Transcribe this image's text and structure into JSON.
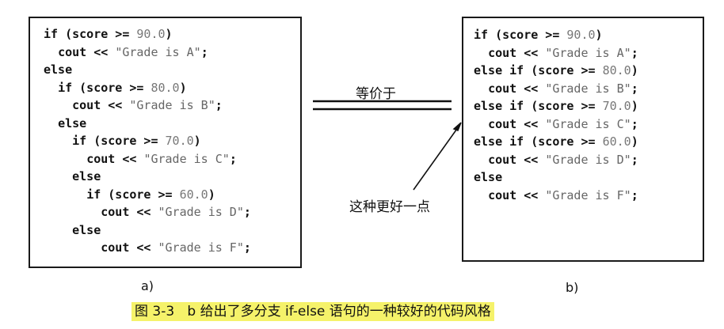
{
  "panel_a": {
    "label": "a)",
    "lines": [
      {
        "indent": 0,
        "parts": [
          [
            "kw",
            "if (score >= "
          ],
          [
            "num",
            "90.0"
          ],
          [
            "kw",
            ")"
          ]
        ]
      },
      {
        "indent": 1,
        "parts": [
          [
            "kw",
            "cout << "
          ],
          [
            "str",
            "\"Grade is A\""
          ],
          [
            "kw",
            ";"
          ]
        ]
      },
      {
        "indent": 0,
        "parts": [
          [
            "kw",
            "else"
          ]
        ]
      },
      {
        "indent": 1,
        "parts": [
          [
            "kw",
            "if (score >= "
          ],
          [
            "num",
            "80.0"
          ],
          [
            "kw",
            ")"
          ]
        ]
      },
      {
        "indent": 2,
        "parts": [
          [
            "kw",
            "cout << "
          ],
          [
            "str",
            "\"Grade is B\""
          ],
          [
            "kw",
            ";"
          ]
        ]
      },
      {
        "indent": 1,
        "parts": [
          [
            "kw",
            "else"
          ]
        ]
      },
      {
        "indent": 2,
        "parts": [
          [
            "kw",
            "if (score >= "
          ],
          [
            "num",
            "70.0"
          ],
          [
            "kw",
            ")"
          ]
        ]
      },
      {
        "indent": 3,
        "parts": [
          [
            "kw",
            "cout << "
          ],
          [
            "str",
            "\"Grade is C\""
          ],
          [
            "kw",
            ";"
          ]
        ]
      },
      {
        "indent": 2,
        "parts": [
          [
            "kw",
            "else"
          ]
        ]
      },
      {
        "indent": 3,
        "parts": [
          [
            "kw",
            "if (score >= "
          ],
          [
            "num",
            "60.0"
          ],
          [
            "kw",
            ")"
          ]
        ]
      },
      {
        "indent": 4,
        "parts": [
          [
            "kw",
            "cout << "
          ],
          [
            "str",
            "\"Grade is D\""
          ],
          [
            "kw",
            ";"
          ]
        ]
      },
      {
        "indent": 2,
        "parts": [
          [
            "kw",
            "else"
          ]
        ]
      },
      {
        "indent": 4,
        "parts": [
          [
            "kw",
            "cout << "
          ],
          [
            "str",
            "\"Grade is F\""
          ],
          [
            "kw",
            ";"
          ]
        ]
      }
    ]
  },
  "panel_b": {
    "label": "b)",
    "lines": [
      {
        "indent": 0,
        "parts": [
          [
            "kw",
            "if (score >= "
          ],
          [
            "num",
            "90.0"
          ],
          [
            "kw",
            ")"
          ]
        ]
      },
      {
        "indent": 1,
        "parts": [
          [
            "kw",
            "cout << "
          ],
          [
            "str",
            "\"Grade is A\""
          ],
          [
            "kw",
            ";"
          ]
        ]
      },
      {
        "indent": 0,
        "parts": [
          [
            "kw",
            "else if (score >= "
          ],
          [
            "num",
            "80.0"
          ],
          [
            "kw",
            ")"
          ]
        ]
      },
      {
        "indent": 1,
        "parts": [
          [
            "kw",
            "cout << "
          ],
          [
            "str",
            "\"Grade is B\""
          ],
          [
            "kw",
            ";"
          ]
        ]
      },
      {
        "indent": 0,
        "parts": [
          [
            "kw",
            "else if (score >= "
          ],
          [
            "num",
            "70.0"
          ],
          [
            "kw",
            ")"
          ]
        ]
      },
      {
        "indent": 1,
        "parts": [
          [
            "kw",
            "cout << "
          ],
          [
            "str",
            "\"Grade is C\""
          ],
          [
            "kw",
            ";"
          ]
        ]
      },
      {
        "indent": 0,
        "parts": [
          [
            "kw",
            "else if (score >= "
          ],
          [
            "num",
            "60.0"
          ],
          [
            "kw",
            ")"
          ]
        ]
      },
      {
        "indent": 1,
        "parts": [
          [
            "kw",
            "cout << "
          ],
          [
            "str",
            "\"Grade is D\""
          ],
          [
            "kw",
            ";"
          ]
        ]
      },
      {
        "indent": 0,
        "parts": [
          [
            "kw",
            "else"
          ]
        ]
      },
      {
        "indent": 1,
        "parts": [
          [
            "kw",
            "cout << "
          ],
          [
            "str",
            "\"Grade is F\""
          ],
          [
            "kw",
            ";"
          ]
        ]
      }
    ]
  },
  "equivalence_label": "等价于",
  "annotation": "这种更好一点",
  "caption": "图 3-3   b 给出了多分支 if-else 语句的一种较好的代码风格",
  "colors": {
    "caption_highlight": "#f5f26a",
    "code_text": "#111111",
    "literal_text": "#666666"
  }
}
